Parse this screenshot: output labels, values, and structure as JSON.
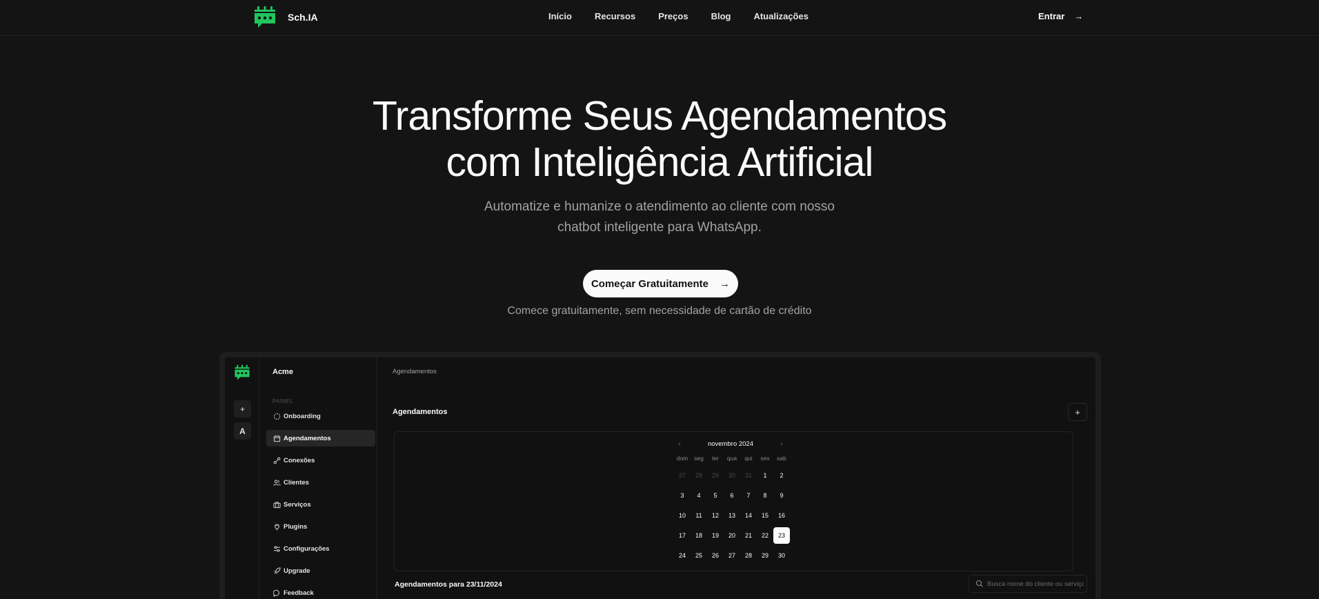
{
  "nav": {
    "brand": "Sch.IA",
    "links": [
      "Início",
      "Recursos",
      "Preços",
      "Blog",
      "Atualizações"
    ],
    "login": "Entrar"
  },
  "hero": {
    "title_line1": "Transforme Seus Agendamentos",
    "title_line2": "com Inteligência Artificial",
    "subtitle_line1": "Automatize e humanize o atendimento ao cliente com nosso",
    "subtitle_line2": "chatbot inteligente para WhatsApp.",
    "cta": "Começar Gratuitamente",
    "note": "Comece gratuitamente, sem necessidade de cartão de crédito"
  },
  "app": {
    "rail": {
      "add": "+",
      "avatar": "A"
    },
    "org": "Acme",
    "section": "PAINEL",
    "menu": [
      {
        "label": "Onboarding",
        "icon": "onboarding-icon"
      },
      {
        "label": "Agendamentos",
        "icon": "calendar-icon",
        "active": true
      },
      {
        "label": "Conexões",
        "icon": "connections-icon"
      },
      {
        "label": "Clientes",
        "icon": "users-icon"
      },
      {
        "label": "Serviços",
        "icon": "briefcase-icon"
      },
      {
        "label": "Plugins",
        "icon": "plug-icon"
      },
      {
        "label": "Configurações",
        "icon": "settings-icon"
      },
      {
        "label": "Upgrade",
        "icon": "rocket-icon"
      },
      {
        "label": "Feedback",
        "icon": "message-icon"
      }
    ],
    "breadcrumb": "Agendamentos",
    "title": "Agendamentos",
    "add": "+",
    "calendar": {
      "month": "novembro 2024",
      "weekdays": [
        "dom",
        "seg",
        "ter",
        "qua",
        "qui",
        "sex",
        "sab"
      ],
      "weeks": [
        [
          "27",
          "28",
          "29",
          "30",
          "31",
          "1",
          "2"
        ],
        [
          "3",
          "4",
          "5",
          "6",
          "7",
          "8",
          "9"
        ],
        [
          "10",
          "11",
          "12",
          "13",
          "14",
          "15",
          "16"
        ],
        [
          "17",
          "18",
          "19",
          "20",
          "21",
          "22",
          "23"
        ],
        [
          "24",
          "25",
          "26",
          "27",
          "28",
          "29",
          "30"
        ]
      ],
      "outside_days_first_week": 5,
      "selected": "23"
    },
    "day_title": "Agendamentos para 23/11/2024",
    "search_placeholder": "Busca nome do cliente ou serviço"
  },
  "colors": {
    "background": "#141414",
    "accent_green": "#22c55e",
    "text": "#fafafa",
    "muted": "#a3a3a3"
  }
}
